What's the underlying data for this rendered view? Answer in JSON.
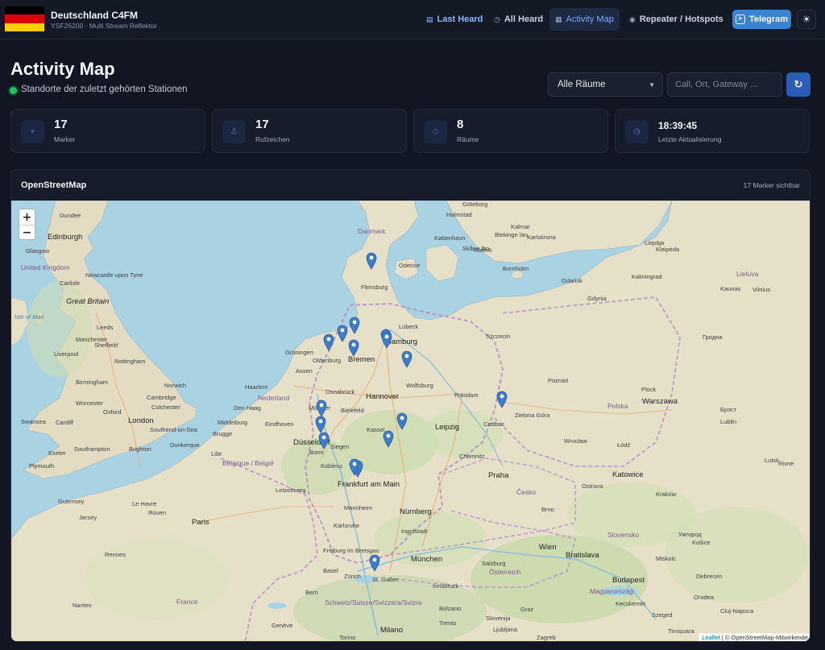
{
  "brand": {
    "title": "Deutschland C4FM",
    "subtitle": "YSF26200 · Multi Stream Reflektor",
    "flag_colors": [
      "#000000",
      "#dd0000",
      "#ffce00"
    ]
  },
  "nav": {
    "items": [
      {
        "label": "Last Heard",
        "icon": "list-icon"
      },
      {
        "label": "All Heard",
        "icon": "clock-icon"
      },
      {
        "label": "Activity Map",
        "icon": "map-icon",
        "active": true
      },
      {
        "label": "Repeater / Hotspots",
        "icon": "radio-icon"
      }
    ],
    "telegram_label": "Telegram",
    "theme_icon": "sun-icon"
  },
  "page": {
    "title": "Activity Map",
    "subtitle": "Standorte der zuletzt gehörten Stationen",
    "room_select_value": "Alle Räume",
    "search_placeholder": "Call, Ort, Gateway ...",
    "refresh_icon": "refresh-icon"
  },
  "stats": [
    {
      "value": "17",
      "label": "Marker",
      "icon": "crosshair-icon"
    },
    {
      "value": "17",
      "label": "Rufzeichen",
      "icon": "person-icon"
    },
    {
      "value": "8",
      "label": "Räume",
      "icon": "diamond-icon"
    },
    {
      "value": "18:39:45",
      "label": "Letzte Aktualisierung",
      "icon": "clock-icon"
    }
  ],
  "map": {
    "title": "OpenStreetMap",
    "visible_count": "17 Marker sichtbar",
    "zoom_in": "+",
    "zoom_out": "−",
    "attribution_leaflet": "Leaflet",
    "attribution_rest": " | © OpenStreetMap-Mitwirkende",
    "places": [
      "Dundee",
      "Edinburgh",
      "Glasgow",
      "United Kingdom",
      "Newcastle upon Tyne",
      "Carlisle",
      "Great Britain",
      "Isle of Man",
      "Leeds",
      "Liverpool",
      "Sheffield",
      "Manchester",
      "Nottingham",
      "Birmingham",
      "Norwich",
      "Cambridge",
      "Worcester",
      "Colchester",
      "Oxford",
      "London",
      "Cardiff",
      "Swansea",
      "Southampton",
      "Brighton",
      "Southend-on-Sea",
      "Plymouth",
      "Exeter",
      "Guernsey",
      "Jersey",
      "Danmark",
      "Halmstad",
      "Göteborg",
      "Odense",
      "København",
      "Flensburg",
      "Lübeck",
      "Hamburg",
      "Bremen",
      "Groningen",
      "Oldenburg",
      "Assen",
      "Haarlem",
      "Nederland",
      "Den Haag",
      "Osnabrück",
      "Hannover",
      "Wolfsburg",
      "Potsdam",
      "Bielefeld",
      "Münster",
      "Kassel",
      "Leipzig",
      "Middelburg",
      "Eindhoven",
      "Brugge",
      "Dunkerque",
      "Düsseldorf",
      "Bonn",
      "Siegen",
      "Koblenz",
      "Lille",
      "Belgique / België",
      "Chemnitz",
      "Praha",
      "Frankfurt am Main",
      "Letzebuerg",
      "Mannheim",
      "Nürnberg",
      "Le Havre",
      "Rouen",
      "Paris",
      "Karlsruhe",
      "Ingolstadt",
      "Freiburg im Breisgau",
      "München",
      "Zürich",
      "St. Gallen",
      "Basel",
      "Rennes",
      "Nantes",
      "France",
      "Bern",
      "Schweiz/Suisse/Svizzera/Svizra",
      "Genève",
      "Torino",
      "Milano",
      "Bolzano",
      "Trento",
      "Innsbruck",
      "Salzburg",
      "Österreich",
      "Wien",
      "Bratislava",
      "Brno",
      "Česko",
      "Ostrava",
      "Katowice",
      "Polska",
      "Łódź",
      "Warszawa",
      "Gdańsk",
      "Gdynia",
      "Szczecin",
      "Poznań",
      "Wrocław",
      "Zielona Góra",
      "Cottbus",
      "Plock",
      "Kraków",
      "Lublin",
      "Kaliningrad",
      "Kaunas",
      "Lietuva",
      "Vilnius",
      "Klaipėda",
      "Гродна",
      "Брэст",
      "Ljubljana",
      "Slovenija",
      "Zagreb",
      "Graz",
      "Magyarország",
      "Budapest",
      "Kecskemét",
      "Debrecen",
      "Miskolc",
      "Košice",
      "Slovensko",
      "Lutsk",
      "Ужгород",
      "Cluj-Napoca",
      "Oradea",
      "Timișoara",
      "Szeged",
      "Malmö",
      "Kalmar",
      "Blekinge län",
      "Skåne län",
      "Bornholm",
      "Karlskrona",
      "Liepāja",
      "Rivne"
    ]
  },
  "colors": {
    "accent": "#3b82d0",
    "active_nav": "#1e2a44",
    "marker": "#3d7cc9",
    "status_live": "#22c55e"
  }
}
